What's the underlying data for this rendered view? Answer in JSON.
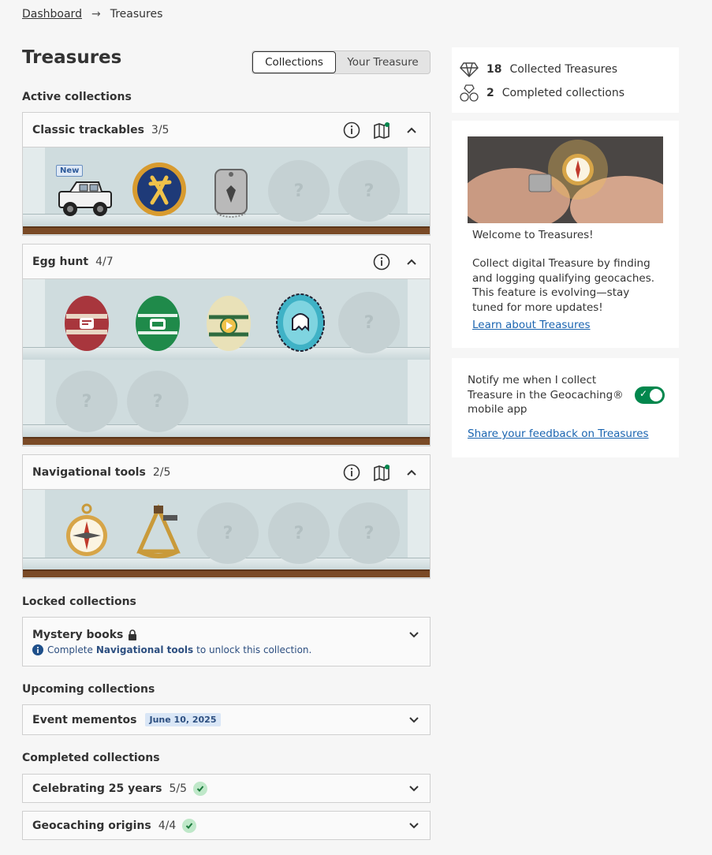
{
  "breadcrumb": {
    "home": "Dashboard",
    "separator": "→",
    "current": "Treasures"
  },
  "page": {
    "title": "Treasures"
  },
  "toggle": {
    "options": [
      "Collections",
      "Your Treasure"
    ],
    "selected": "Collections"
  },
  "sections": {
    "active": "Active collections",
    "locked": "Locked collections",
    "upcoming": "Upcoming collections",
    "completed": "Completed collections"
  },
  "active_collections": [
    {
      "name": "Classic trackables",
      "progress": "3/5",
      "collected": 3,
      "total": 5,
      "new_badge": "New",
      "icons": [
        "info-icon",
        "map-icon",
        "chevron-up-icon"
      ]
    },
    {
      "name": "Egg hunt",
      "progress": "4/7",
      "collected": 4,
      "total": 7,
      "icons": [
        "info-icon",
        "chevron-up-icon"
      ]
    },
    {
      "name": "Navigational tools",
      "progress": "2/5",
      "collected": 2,
      "total": 5,
      "icons": [
        "info-icon",
        "map-icon",
        "chevron-up-icon"
      ]
    }
  ],
  "empty_slot_symbol": "?",
  "locked_collections": [
    {
      "name": "Mystery books",
      "note_prefix": "Complete",
      "note_link": "Navigational tools",
      "note_suffix": "to unlock this collection."
    }
  ],
  "upcoming_collections": [
    {
      "name": "Event mementos",
      "date": "June 10, 2025"
    }
  ],
  "completed_collections": [
    {
      "name": "Celebrating 25 years",
      "progress": "5/5"
    },
    {
      "name": "Geocaching origins",
      "progress": "4/4"
    }
  ],
  "stats": {
    "collected_count": "18",
    "collected_label": "Collected Treasures",
    "completed_count": "2",
    "completed_label": "Completed collections"
  },
  "welcome": {
    "heading": "Welcome to Treasures!",
    "body": "Collect digital Treasure by finding and logging qualifying geocaches. This feature is evolving—stay tuned for more updates!",
    "link": "Learn about Treasures"
  },
  "notify": {
    "text": "Notify me when I collect Treasure in the Geocaching® mobile app",
    "enabled": true,
    "feedback_link": "Share your feedback on Treasures"
  },
  "colors": {
    "accent_green": "#02874d",
    "link_blue": "#1a64b0",
    "wood": "#7a4a26"
  }
}
